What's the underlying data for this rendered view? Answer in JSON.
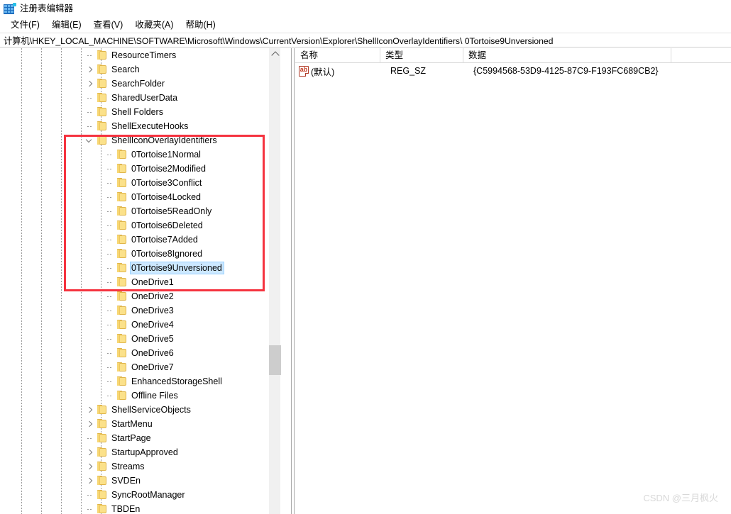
{
  "window": {
    "title": "注册表编辑器",
    "icon": "registry-editor-icon"
  },
  "menu": {
    "items": [
      {
        "label": "文件(F)",
        "name": "menu-file"
      },
      {
        "label": "编辑(E)",
        "name": "menu-edit"
      },
      {
        "label": "查看(V)",
        "name": "menu-view"
      },
      {
        "label": "收藏夹(A)",
        "name": "menu-favorites"
      },
      {
        "label": "帮助(H)",
        "name": "menu-help"
      }
    ]
  },
  "address": {
    "path": "计算机\\HKEY_LOCAL_MACHINE\\SOFTWARE\\Microsoft\\Windows\\CurrentVersion\\Explorer\\ShellIconOverlayIdentifiers\\  0Tortoise9Unversioned"
  },
  "tree": {
    "nodes": [
      {
        "label": "ResourceTimers",
        "indent": 5,
        "expander": "none",
        "selected": false
      },
      {
        "label": "Search",
        "indent": 5,
        "expander": "right",
        "selected": false
      },
      {
        "label": "SearchFolder",
        "indent": 5,
        "expander": "right",
        "selected": false
      },
      {
        "label": "SharedUserData",
        "indent": 5,
        "expander": "none",
        "selected": false
      },
      {
        "label": "Shell Folders",
        "indent": 5,
        "expander": "none",
        "selected": false
      },
      {
        "label": "ShellExecuteHooks",
        "indent": 5,
        "expander": "none",
        "selected": false
      },
      {
        "label": "ShellIconOverlayIdentifiers",
        "indent": 5,
        "expander": "down",
        "selected": false
      },
      {
        "label": "0Tortoise1Normal",
        "indent": 6,
        "expander": "none",
        "selected": false
      },
      {
        "label": "0Tortoise2Modified",
        "indent": 6,
        "expander": "none",
        "selected": false
      },
      {
        "label": "0Tortoise3Conflict",
        "indent": 6,
        "expander": "none",
        "selected": false
      },
      {
        "label": "0Tortoise4Locked",
        "indent": 6,
        "expander": "none",
        "selected": false
      },
      {
        "label": "0Tortoise5ReadOnly",
        "indent": 6,
        "expander": "none",
        "selected": false
      },
      {
        "label": "0Tortoise6Deleted",
        "indent": 6,
        "expander": "none",
        "selected": false
      },
      {
        "label": "0Tortoise7Added",
        "indent": 6,
        "expander": "none",
        "selected": false
      },
      {
        "label": "0Tortoise8Ignored",
        "indent": 6,
        "expander": "none",
        "selected": false
      },
      {
        "label": "0Tortoise9Unversioned",
        "indent": 6,
        "expander": "none",
        "selected": true
      },
      {
        "label": "OneDrive1",
        "indent": 6,
        "expander": "none",
        "selected": false
      },
      {
        "label": "OneDrive2",
        "indent": 6,
        "expander": "none",
        "selected": false
      },
      {
        "label": "OneDrive3",
        "indent": 6,
        "expander": "none",
        "selected": false
      },
      {
        "label": "OneDrive4",
        "indent": 6,
        "expander": "none",
        "selected": false
      },
      {
        "label": "OneDrive5",
        "indent": 6,
        "expander": "none",
        "selected": false
      },
      {
        "label": "OneDrive6",
        "indent": 6,
        "expander": "none",
        "selected": false
      },
      {
        "label": "OneDrive7",
        "indent": 6,
        "expander": "none",
        "selected": false
      },
      {
        "label": "EnhancedStorageShell",
        "indent": 6,
        "expander": "none",
        "selected": false
      },
      {
        "label": "Offline Files",
        "indent": 6,
        "expander": "none",
        "selected": false
      },
      {
        "label": "ShellServiceObjects",
        "indent": 5,
        "expander": "right",
        "selected": false
      },
      {
        "label": "StartMenu",
        "indent": 5,
        "expander": "right",
        "selected": false
      },
      {
        "label": "StartPage",
        "indent": 5,
        "expander": "none",
        "selected": false
      },
      {
        "label": "StartupApproved",
        "indent": 5,
        "expander": "right",
        "selected": false
      },
      {
        "label": "Streams",
        "indent": 5,
        "expander": "right",
        "selected": false
      },
      {
        "label": "SVDEn",
        "indent": 5,
        "expander": "right",
        "selected": false
      },
      {
        "label": "SyncRootManager",
        "indent": 5,
        "expander": "none",
        "selected": false
      },
      {
        "label": "TBDEn",
        "indent": 5,
        "expander": "none",
        "selected": false
      }
    ]
  },
  "list": {
    "columns": [
      {
        "label": "名称",
        "name": "column-header-name"
      },
      {
        "label": "类型",
        "name": "column-header-type"
      },
      {
        "label": "数据",
        "name": "column-header-data"
      }
    ],
    "rows": [
      {
        "icon": "string-value-icon",
        "name": "(默认)",
        "type": "REG_SZ",
        "data": "{C5994568-53D9-4125-87C9-F193FC689CB2}"
      }
    ]
  },
  "annotation": {
    "color": "#f5333f"
  },
  "watermark": {
    "text": "CSDN @三月枫火"
  }
}
